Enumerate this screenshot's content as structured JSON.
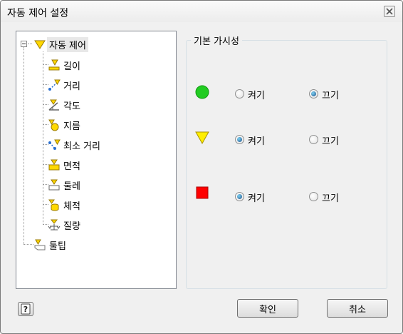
{
  "window": {
    "title": "자동 제어 설정"
  },
  "tree": {
    "root": {
      "label": "자동 제어",
      "icon": "triangle-icon"
    },
    "children": [
      {
        "label": "길이",
        "icon": "length-icon"
      },
      {
        "label": "거리",
        "icon": "distance-icon"
      },
      {
        "label": "각도",
        "icon": "angle-icon"
      },
      {
        "label": "지름",
        "icon": "diameter-icon"
      },
      {
        "label": "최소 거리",
        "icon": "min-distance-icon"
      },
      {
        "label": "면적",
        "icon": "area-icon"
      },
      {
        "label": "둘레",
        "icon": "perimeter-icon"
      },
      {
        "label": "체적",
        "icon": "volume-icon"
      },
      {
        "label": "질량",
        "icon": "mass-icon"
      }
    ],
    "tooltip": {
      "label": "툴팁",
      "icon": "tooltip-icon"
    }
  },
  "visibility": {
    "title": "기본 가시성",
    "rows": [
      {
        "shape": "circle",
        "color": "#22cc22",
        "on_label": "켜기",
        "off_label": "끄기",
        "selected": "off"
      },
      {
        "shape": "triangle",
        "color": "#ffee00",
        "on_label": "켜기",
        "off_label": "끄기",
        "selected": "on"
      },
      {
        "shape": "square",
        "color": "#ff0000",
        "on_label": "켜기",
        "off_label": "끄기",
        "selected": "on"
      }
    ]
  },
  "buttons": {
    "ok": "확인",
    "cancel": "취소",
    "help_icon": "help-icon"
  }
}
